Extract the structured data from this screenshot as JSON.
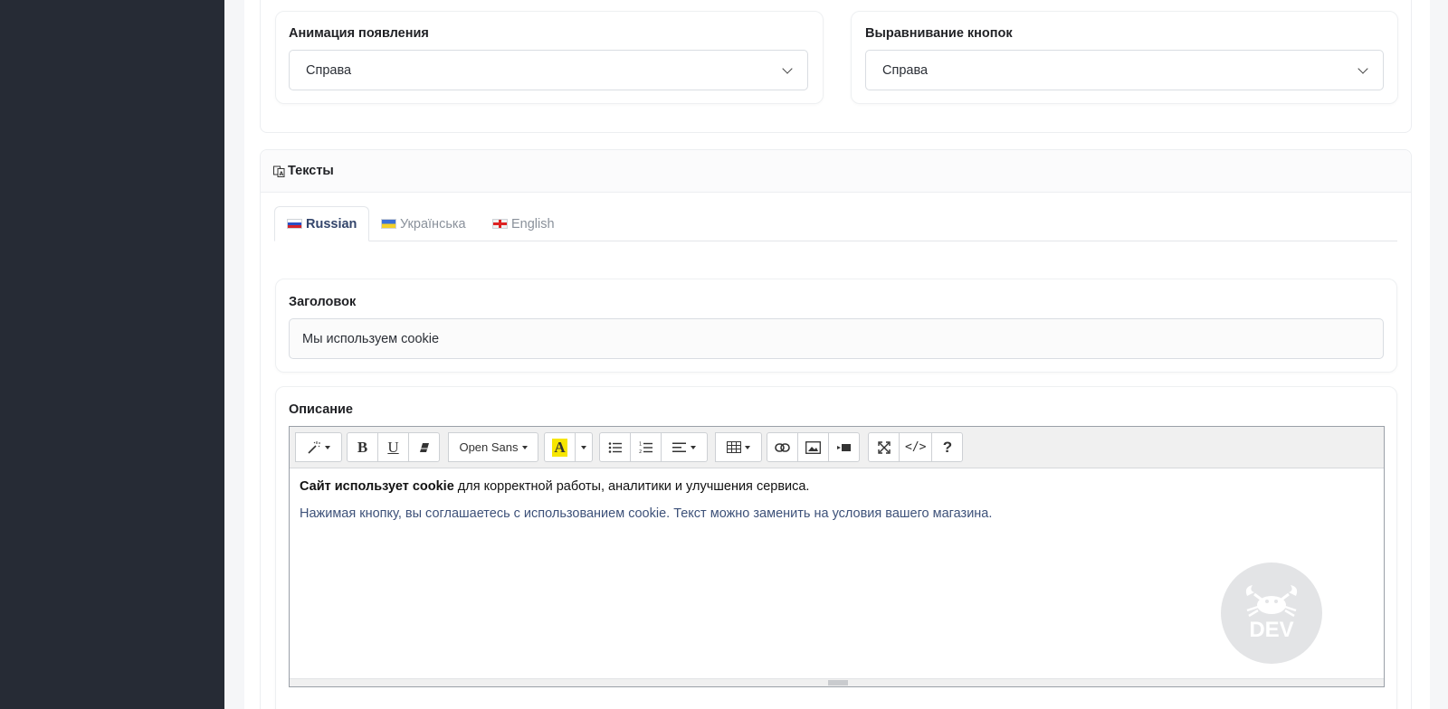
{
  "settings": {
    "appear_animation": {
      "label": "Анимация появления",
      "value": "Справа"
    },
    "buttons_alignment": {
      "label": "Выравнивание кнопок",
      "value": "Справа"
    }
  },
  "texts": {
    "header": {
      "icon": "translate-icon",
      "title": "Тексты"
    },
    "tabs": [
      {
        "label": "Russian",
        "flag": "flag-ru",
        "active": true
      },
      {
        "label": "Українська",
        "flag": "flag-ua",
        "active": false
      },
      {
        "label": "English",
        "flag": "flag-en",
        "active": false
      }
    ],
    "heading_field": {
      "label": "Заголовок",
      "value": "Мы используем cookie"
    },
    "description": {
      "label": "Описание",
      "toolbar": {
        "font": "Open Sans"
      },
      "content": {
        "line1_bold": "Сайт использует cookie",
        "line1_rest": " для корректной работы, аналитики и улучшения сервиса.",
        "line2": "Нажимая кнопку, вы соглашаетесь с использованием cookie. Текст можно заменить на условия вашего магазина."
      }
    }
  },
  "watermark": {
    "text": "DEV"
  },
  "colors": {
    "sidebar": "#262b35",
    "active_tab_text": "#33456b",
    "line2_text": "#3d5179"
  }
}
